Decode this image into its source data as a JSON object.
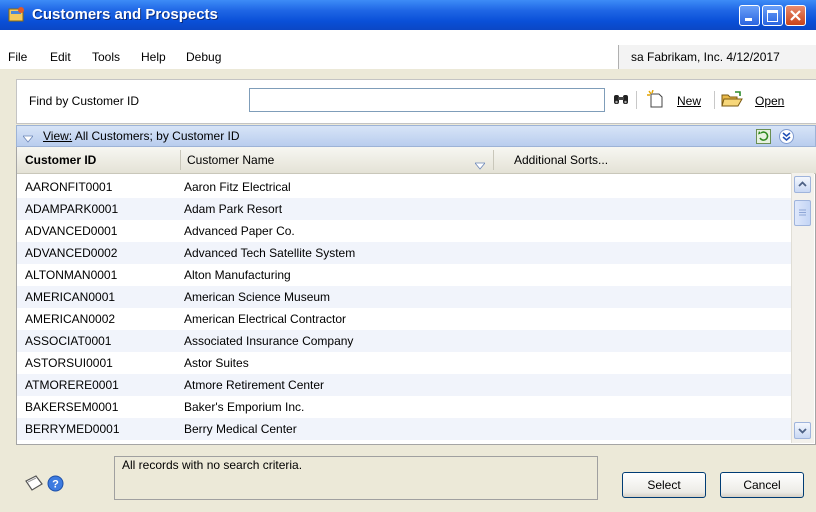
{
  "window": {
    "title": "Customers and Prospects"
  },
  "menu": {
    "items": [
      "File",
      "Edit",
      "Tools",
      "Help",
      "Debug"
    ],
    "status": "sa  Fabrikam, Inc.  4/12/2017"
  },
  "find": {
    "label": "Find by Customer ID",
    "value": "",
    "new_label": "New",
    "open_label": "Open"
  },
  "view": {
    "prefix": "View:",
    "text": " All Customers; by Customer ID"
  },
  "grid": {
    "columns": [
      "Customer ID",
      "Customer Name",
      "Additional Sorts..."
    ],
    "rows": [
      {
        "id": "AARONFIT0001",
        "name": "Aaron Fitz Electrical"
      },
      {
        "id": "ADAMPARK0001",
        "name": "Adam Park Resort"
      },
      {
        "id": "ADVANCED0001",
        "name": "Advanced Paper Co."
      },
      {
        "id": "ADVANCED0002",
        "name": "Advanced Tech Satellite System"
      },
      {
        "id": "ALTONMAN0001",
        "name": "Alton Manufacturing"
      },
      {
        "id": "AMERICAN0001",
        "name": "American Science Museum"
      },
      {
        "id": "AMERICAN0002",
        "name": "American Electrical Contractor"
      },
      {
        "id": "ASSOCIAT0001",
        "name": "Associated Insurance Company"
      },
      {
        "id": "ASTORSUI0001",
        "name": "Astor Suites"
      },
      {
        "id": "ATMORERE0001",
        "name": "Atmore Retirement Center"
      },
      {
        "id": "BAKERSEM0001",
        "name": "Baker's Emporium Inc."
      },
      {
        "id": "BERRYMED0001",
        "name": "Berry Medical Center"
      }
    ]
  },
  "footer": {
    "status_text": "All records with no search criteria.",
    "select_label": "Select",
    "cancel_label": "Cancel"
  },
  "colors": {
    "titlebar": "#0a50d8",
    "view_bar": "#c8d8f2",
    "row_alt": "#f1f4fb",
    "window_bg": "#ece9d8"
  },
  "icons": [
    "app-icon",
    "minimize-icon",
    "maximize-icon",
    "close-icon",
    "binoculars-icon",
    "new-doc-icon",
    "open-folder-icon",
    "view-chevron-icon",
    "refresh-icon",
    "expand-icon",
    "note-icon",
    "help-icon"
  ]
}
